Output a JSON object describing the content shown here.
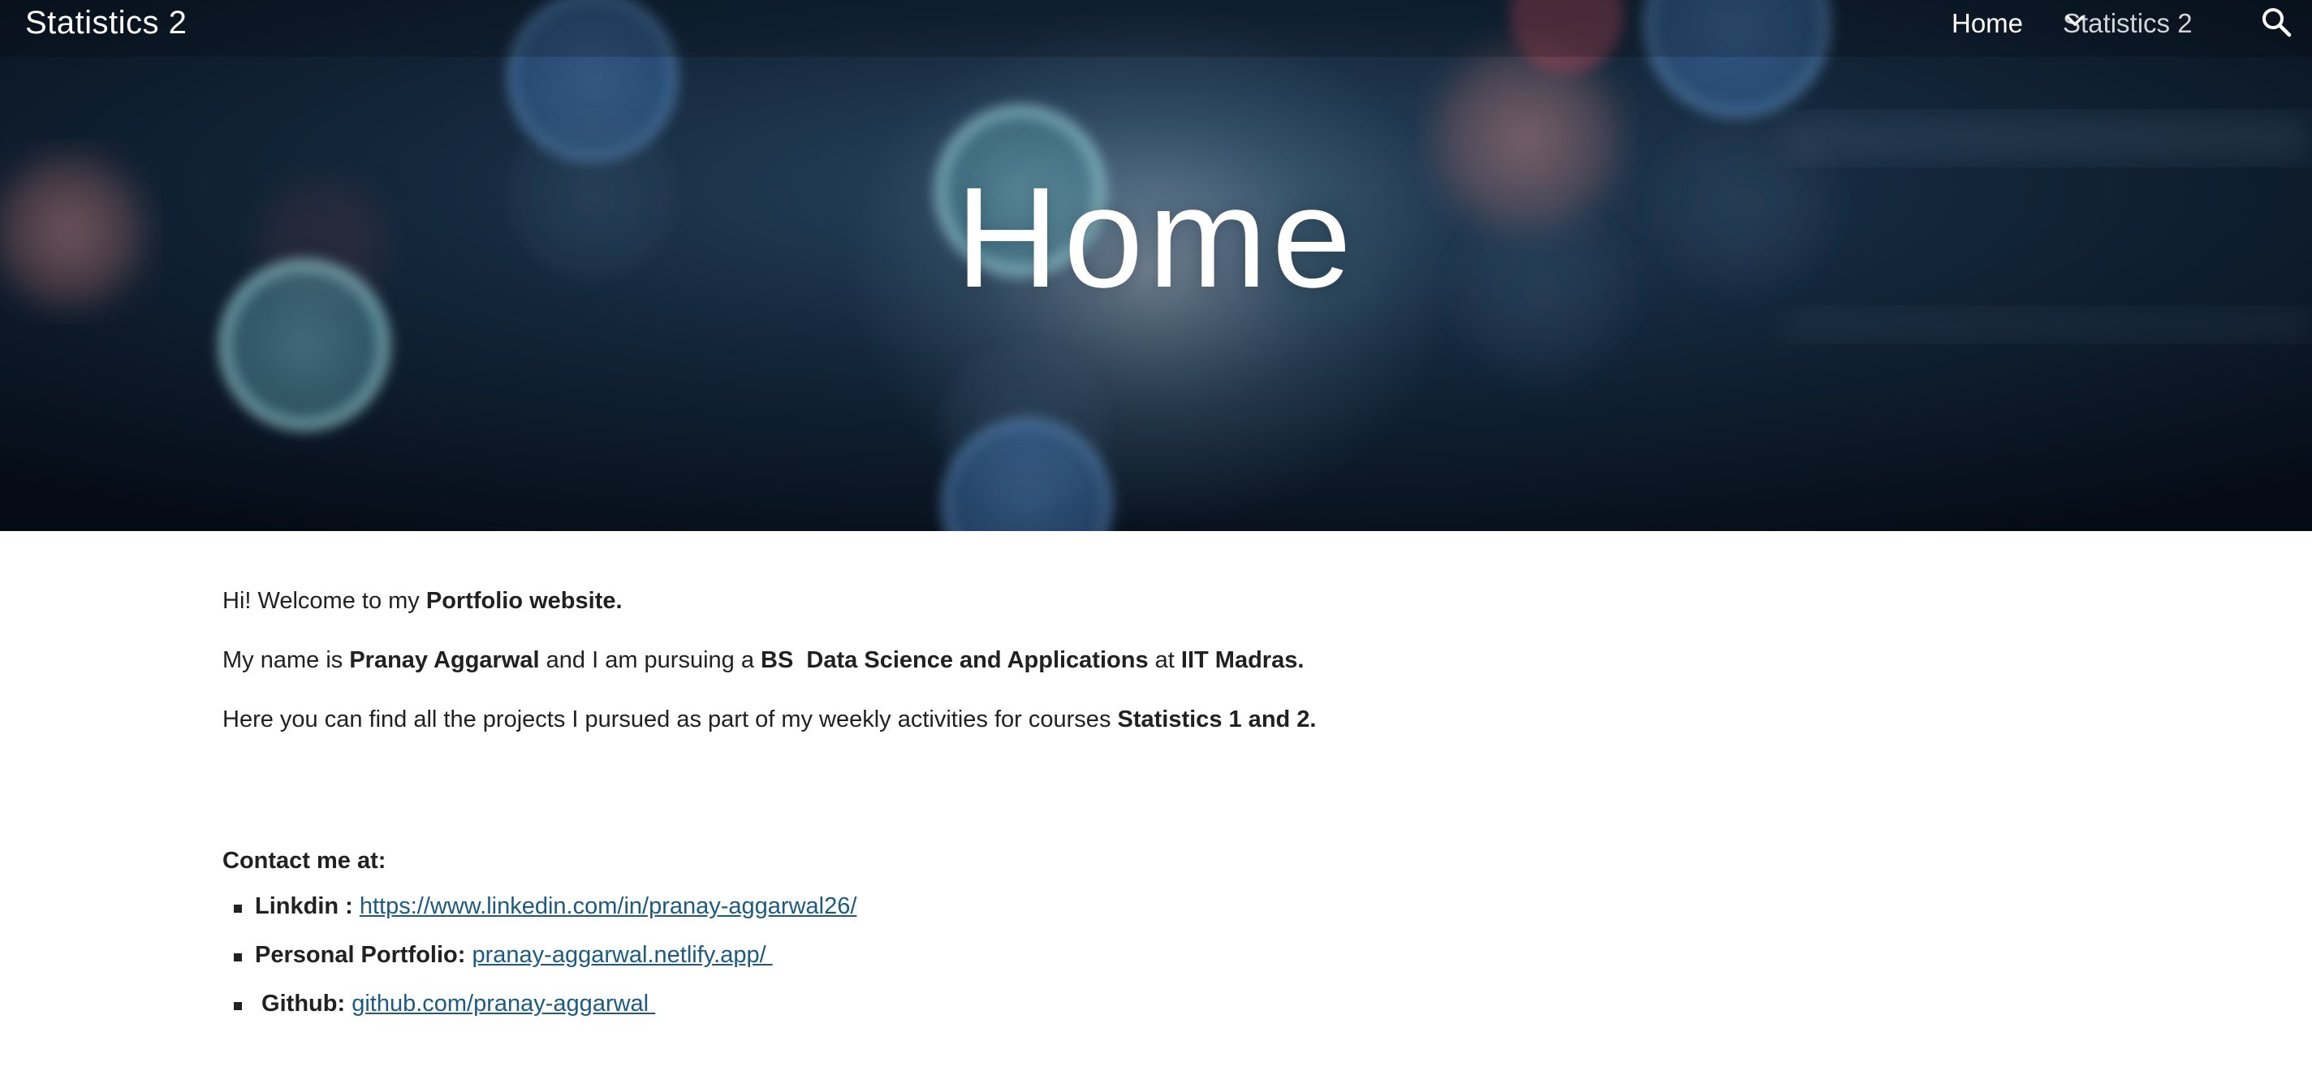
{
  "header": {
    "site_title": "Statistics 2",
    "nav": {
      "home_label": "Home",
      "statistics_label": "Statistics 2"
    },
    "icons": {
      "dropdown": "chevron-down-icon",
      "search": "search-icon"
    }
  },
  "hero": {
    "title": "Home"
  },
  "main": {
    "paragraphs": [
      {
        "p1_a": "Hi! Welcome to my ",
        "p1_b": "Portfolio website."
      },
      {
        "p2_a": "My name is ",
        "p2_b": "Pranay Aggarwal",
        "p2_c": " and I am pursuing a ",
        "p2_d": "BS  Data Science and Applications",
        "p2_e": " at ",
        "p2_f": "IIT Madras",
        "p2_g": "."
      },
      {
        "p3_a": "Here you can find all the projects I pursued as part of my weekly activities for courses ",
        "p3_b": "Statistics 1 and 2."
      }
    ],
    "contact": {
      "heading": "Contact me at:",
      "items": [
        {
          "label": "Linkdin : ",
          "link": "https://www.linkedin.com/in/pranay-aggarwal26/"
        },
        {
          "label": "Personal Portfolio: ",
          "link": "pranay-aggarwal.netlify.app/ "
        },
        {
          "label": " Github: ",
          "link": "github.com/pranay-aggarwal "
        }
      ]
    }
  },
  "colors": {
    "link": "#1d5a82",
    "text": "#212121",
    "hero_bg": "#0a1522"
  }
}
